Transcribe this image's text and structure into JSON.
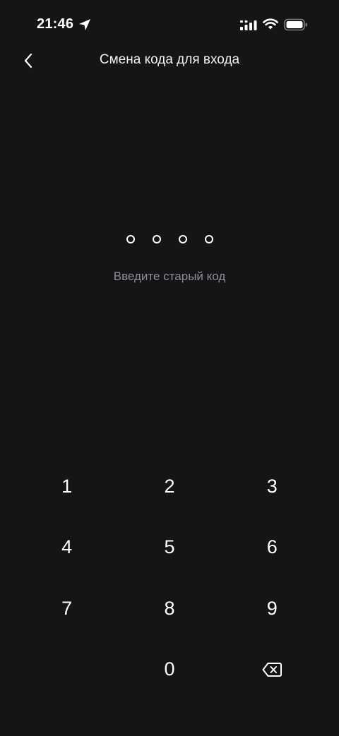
{
  "status_bar": {
    "time": "21:46",
    "icons": [
      "location-arrow-icon",
      "cellular-signal-icon",
      "wifi-icon",
      "battery-icon"
    ]
  },
  "header": {
    "back_icon": "chevron-left-icon",
    "title": "Смена кода для входа"
  },
  "pin": {
    "length": 4,
    "entered": 0
  },
  "prompt": "Введите старый код",
  "keypad": {
    "keys": [
      "1",
      "2",
      "3",
      "4",
      "5",
      "6",
      "7",
      "8",
      "9",
      "",
      "0",
      "backspace"
    ],
    "backspace_icon": "backspace-icon"
  },
  "colors": {
    "background": "#151517",
    "text": "#ffffff",
    "muted": "#8e8e93"
  }
}
